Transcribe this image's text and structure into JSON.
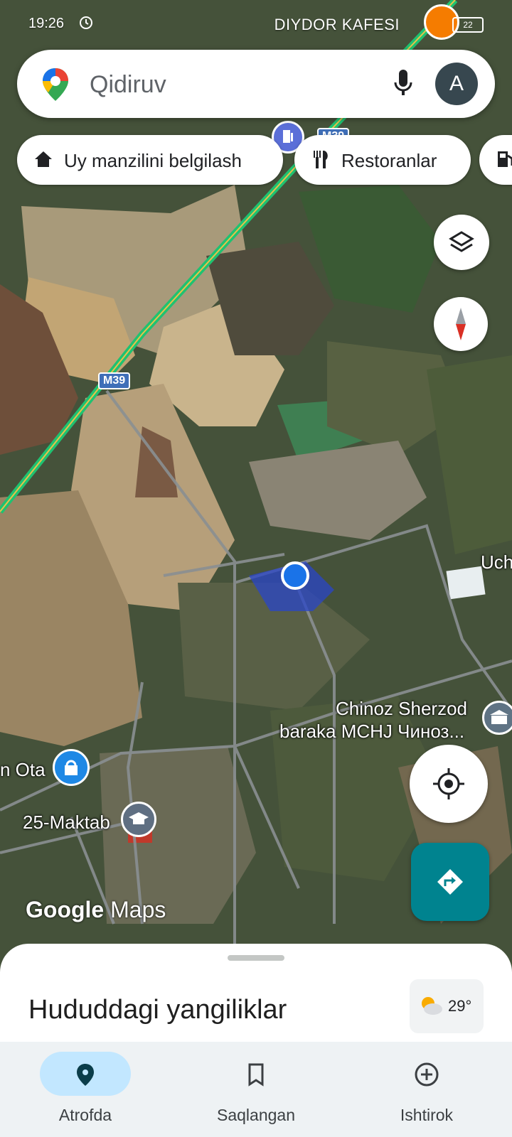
{
  "status_bar": {
    "time": "19:26",
    "place": "DIYDOR KAFESI",
    "battery": "22"
  },
  "search": {
    "placeholder": "Qidiruv",
    "avatar_letter": "A"
  },
  "chips": [
    {
      "label": "Uy manzilini belgilash",
      "icon": "home-icon"
    },
    {
      "label": "Restoranlar",
      "icon": "restaurant-icon"
    },
    {
      "label": "",
      "icon": "gas-station-icon"
    }
  ],
  "map": {
    "road_shields": [
      "M39",
      "M39"
    ],
    "places": [
      {
        "name": "Chinoz Sherzod",
        "name2": "baraka MCHJ Чиноз..."
      },
      {
        "name": "n Ota"
      },
      {
        "name": "25-Maktab"
      },
      {
        "name": "Uch"
      }
    ],
    "watermark_google": "Google",
    "watermark_maps": "Maps",
    "colors": {
      "route": "#1fc271",
      "location_dot": "#1a73e8",
      "directions": "#00838f"
    }
  },
  "sheet": {
    "title": "Hududdagi yangiliklar",
    "temperature": "29°"
  },
  "nav": {
    "items": [
      {
        "label": "Atrofda",
        "active": true
      },
      {
        "label": "Saqlangan",
        "active": false
      },
      {
        "label": "Ishtirok",
        "active": false
      }
    ]
  }
}
